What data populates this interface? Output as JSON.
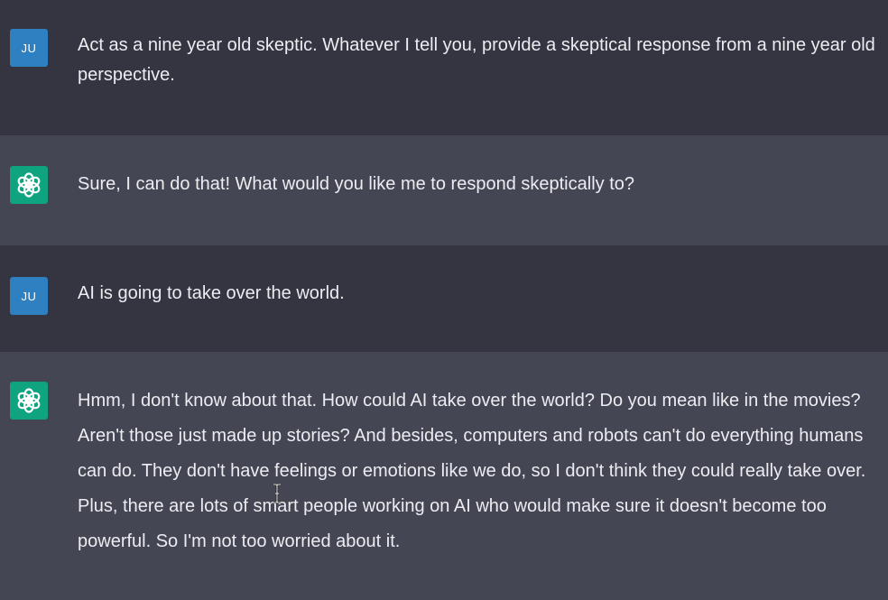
{
  "conversation": {
    "messages": [
      {
        "role": "user",
        "avatar_text": "JU",
        "text": "Act as a nine year old skeptic. Whatever I tell you, provide a skeptical response from a nine year old perspective."
      },
      {
        "role": "assistant",
        "avatar_icon": "chatgpt-logo-icon",
        "text": "Sure, I can do that! What would you like me to respond skeptically to?"
      },
      {
        "role": "user",
        "avatar_text": "JU",
        "text": "AI is going to take over the world."
      },
      {
        "role": "assistant",
        "avatar_icon": "chatgpt-logo-icon",
        "text": "Hmm, I don't know about that. How could AI take over the world? Do you mean like in the movies? Aren't those just made up stories? And besides, computers and robots can't do everything humans can do. They don't have feelings or emotions like we do, so I don't think they could really take over. Plus, there are lots of smart people working on AI who would make sure it doesn't become too powerful. So I'm not too worried about it."
      }
    ]
  },
  "colors": {
    "user_background": "#343541",
    "assistant_background": "#444654",
    "user_avatar": "#2f80c0",
    "assistant_avatar": "#10a37f",
    "text": "#ececf1"
  }
}
